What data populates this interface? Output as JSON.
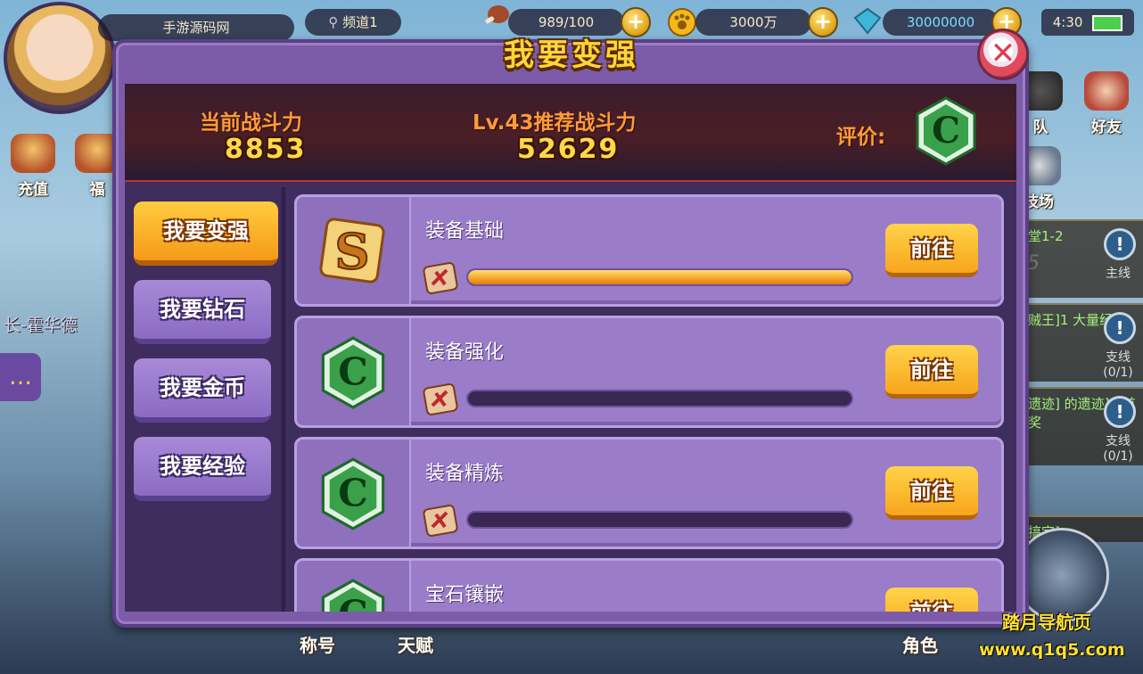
{
  "hud": {
    "server_name": "手游源码网",
    "channel": "频道1",
    "stamina": "989/100",
    "gold": "3000万",
    "diamonds": "30000000",
    "time": "4:30",
    "left_buttons": [
      "充值",
      "福"
    ],
    "right_buttons": [
      "队",
      "好友",
      "技场"
    ],
    "left_name": "长-霍华德",
    "bottom_buttons": [
      "称号",
      "天赋",
      "角色"
    ],
    "quests": [
      {
        "text": "教堂1-2",
        "sub": "15",
        "tag": "主线"
      },
      {
        "text": "海贼王]1 大量经验",
        "sub": "(0/1)",
        "tag": "支线"
      },
      {
        "text": "的遗迹] 的遗迹]1 首饰奖",
        "sub": "(0/1)",
        "tag": "支线"
      },
      {
        "text": "队搞定]",
        "sub": "",
        "tag": ""
      }
    ]
  },
  "watermark": {
    "line1": "踏月导航页",
    "line2": "www.q1q5.com"
  },
  "panel": {
    "title": "我要变强",
    "close_label": "✕",
    "stats": {
      "current_label": "当前战斗力",
      "current_value": "8853",
      "recommended_label": "Lv.43推荐战斗力",
      "recommended_value": "52629",
      "rating_label": "评价:",
      "rating_grade": "C"
    },
    "tabs": [
      {
        "label": "我要变强",
        "active": true
      },
      {
        "label": "我要钻石",
        "active": false
      },
      {
        "label": "我要金币",
        "active": false
      },
      {
        "label": "我要经验",
        "active": false
      }
    ],
    "rows": [
      {
        "title": "装备基础",
        "grade": "S",
        "progress": 1.0,
        "button": "前往"
      },
      {
        "title": "装备强化",
        "grade": "C",
        "progress": 0.0,
        "button": "前往"
      },
      {
        "title": "装备精炼",
        "grade": "C",
        "progress": 0.0,
        "button": "前往"
      },
      {
        "title": "宝石镶嵌",
        "grade": "C",
        "progress": 0.0,
        "button": "前往"
      }
    ]
  },
  "colors": {
    "panel_purple": "#7c5ba8",
    "active_tab_orange": "#f59a18",
    "grade_c_green": "#2e8a3e",
    "grade_s_gold": "#e8a22a",
    "title_yellow": "#ffd53a"
  },
  "icons": {
    "close": "close-x-icon",
    "location": "map-pin-icon",
    "stamina": "meat-icon",
    "gold": "paw-coin-icon",
    "diamond": "diamond-icon",
    "battery": "battery-icon",
    "row_mini": "battle-scroll-icon"
  }
}
